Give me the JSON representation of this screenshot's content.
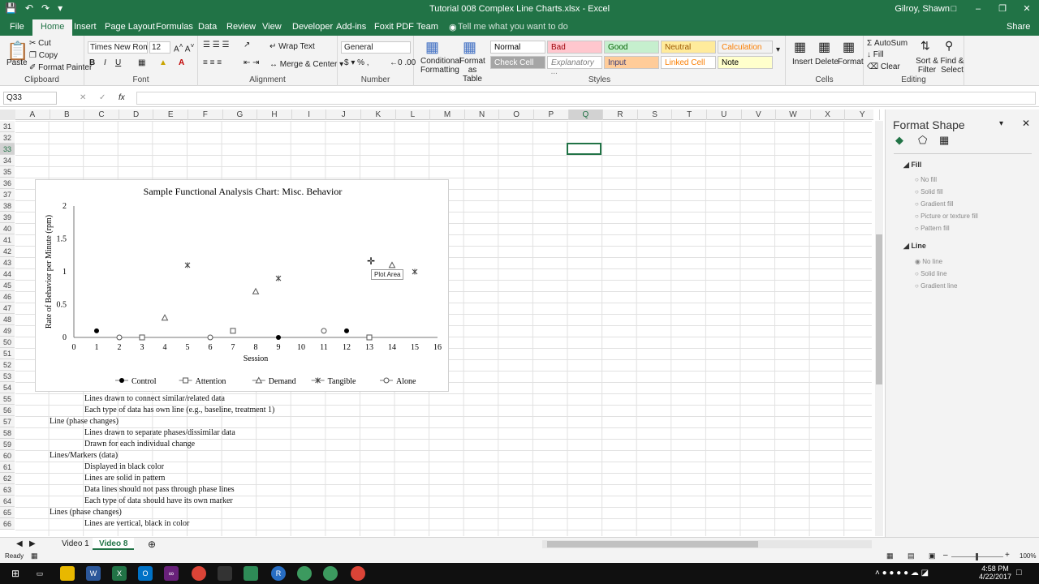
{
  "window": {
    "title": "Tutorial 008 Complex Line Charts.xlsx  -  Excel",
    "user": "Gilroy, Shawn",
    "share": "Share"
  },
  "tabs": [
    "File",
    "Home",
    "Insert",
    "Page Layout",
    "Formulas",
    "Data",
    "Review",
    "View",
    "Developer",
    "Add-ins",
    "Foxit PDF",
    "Team"
  ],
  "tell_me": "Tell me what you want to do",
  "ribbon": {
    "clipboard": {
      "label": "Clipboard",
      "paste": "Paste",
      "cut": "Cut",
      "copy": "Copy",
      "painter": "Format Painter"
    },
    "font": {
      "label": "Font",
      "name": "Times New Roma",
      "size": "12"
    },
    "alignment": {
      "label": "Alignment",
      "wrap": "Wrap Text",
      "merge": "Merge & Center"
    },
    "number": {
      "label": "Number",
      "format": "General"
    },
    "styles": {
      "label": "Styles",
      "cond": "Conditional Formatting",
      "table": "Format as Table",
      "cells": [
        {
          "name": "Normal",
          "bg": "#ffffff",
          "fg": "#000000"
        },
        {
          "name": "Bad",
          "bg": "#ffc7ce",
          "fg": "#9c0006"
        },
        {
          "name": "Good",
          "bg": "#c6efce",
          "fg": "#006100"
        },
        {
          "name": "Neutral",
          "bg": "#ffeb9c",
          "fg": "#9c5700"
        },
        {
          "name": "Calculation",
          "bg": "#f2f2f2",
          "fg": "#fa7d00"
        },
        {
          "name": "Check Cell",
          "bg": "#a5a5a5",
          "fg": "#ffffff"
        },
        {
          "name": "Explanatory ...",
          "bg": "#ffffff",
          "fg": "#7f7f7f"
        },
        {
          "name": "Input",
          "bg": "#ffcc99",
          "fg": "#3f3f76"
        },
        {
          "name": "Linked Cell",
          "bg": "#ffffff",
          "fg": "#fa7d00"
        },
        {
          "name": "Note",
          "bg": "#ffffcc",
          "fg": "#000000"
        }
      ]
    },
    "cells": {
      "label": "Cells",
      "insert": "Insert",
      "delete": "Delete",
      "format": "Format"
    },
    "editing": {
      "label": "Editing",
      "autosum": "AutoSum",
      "fill": "Fill",
      "clear": "Clear",
      "sort": "Sort & Filter",
      "find": "Find & Select"
    }
  },
  "namebox": "Q33",
  "columns": [
    "A",
    "B",
    "C",
    "D",
    "E",
    "F",
    "G",
    "H",
    "I",
    "J",
    "K",
    "L",
    "M",
    "N",
    "O",
    "P",
    "Q",
    "R",
    "S",
    "T",
    "U",
    "V",
    "W",
    "X",
    "Y"
  ],
  "rows": [
    "31",
    "32",
    "33",
    "34",
    "35",
    "36",
    "37",
    "38",
    "39",
    "40",
    "41",
    "42",
    "43",
    "44",
    "45",
    "46",
    "47",
    "48",
    "49",
    "50",
    "51",
    "52",
    "53",
    "54",
    "55",
    "56",
    "57",
    "58",
    "59",
    "60",
    "61",
    "62",
    "63",
    "64",
    "65",
    "66"
  ],
  "sheet_text": [
    {
      "t": "Lines drawn to connect similar/related data",
      "indent": true
    },
    {
      "t": "Each type of data has own line (e.g., baseline, treatment 1)",
      "indent": true
    },
    {
      "t": "Line (phase changes)",
      "indent": false
    },
    {
      "t": "Lines drawn to separate phases/dissimilar data",
      "indent": true
    },
    {
      "t": "Drawn for each individual change",
      "indent": true
    },
    {
      "t": "Lines/Markers (data)",
      "indent": false
    },
    {
      "t": "Displayed in black color",
      "indent": true
    },
    {
      "t": "Lines are solid in pattern",
      "indent": true
    },
    {
      "t": "Data lines should not pass through phase lines",
      "indent": true
    },
    {
      "t": "Each type of data should have its own marker",
      "indent": true
    },
    {
      "t": "Lines (phase changes)",
      "indent": false
    },
    {
      "t": "Lines are vertical, black in color",
      "indent": true
    }
  ],
  "chart_data": {
    "type": "scatter",
    "title": "Sample Functional Analysis Chart: Misc. Behavior",
    "xlabel": "Session",
    "ylabel": "Rate of Behavior per Minute (rpm)",
    "xlim": [
      0,
      16
    ],
    "ylim": [
      0,
      2
    ],
    "xticks": [
      "0",
      "1",
      "2",
      "3",
      "4",
      "5",
      "6",
      "7",
      "8",
      "9",
      "10",
      "11",
      "12",
      "13",
      "14",
      "15",
      "16"
    ],
    "yticks": [
      "0",
      "0.5",
      "1",
      "1.5",
      "2"
    ],
    "legend": "bottom",
    "series": [
      {
        "name": "Control",
        "marker": "filled-circle",
        "points": [
          [
            1,
            0.1
          ],
          [
            9,
            0
          ],
          [
            12,
            0.1
          ]
        ]
      },
      {
        "name": "Attention",
        "marker": "square",
        "points": [
          [
            3,
            0
          ],
          [
            7,
            0.1
          ],
          [
            13,
            0
          ]
        ]
      },
      {
        "name": "Demand",
        "marker": "triangle",
        "points": [
          [
            4,
            0.3
          ],
          [
            8,
            0.7
          ],
          [
            14,
            1.1
          ]
        ]
      },
      {
        "name": "Tangible",
        "marker": "star",
        "points": [
          [
            5,
            1.1
          ],
          [
            9,
            0.9
          ],
          [
            15,
            1.0
          ]
        ]
      },
      {
        "name": "Alone",
        "marker": "circle",
        "points": [
          [
            2,
            0
          ],
          [
            6,
            0
          ],
          [
            11,
            0.1
          ]
        ]
      }
    ],
    "tooltip": "Plot Area"
  },
  "pane": {
    "title": "Format Shape",
    "fill_label": "Fill",
    "fill_opts": [
      "No fill",
      "Solid fill",
      "Gradient fill",
      "Picture or texture fill",
      "Pattern fill"
    ],
    "line_label": "Line",
    "line_opts": [
      "No line",
      "Solid line",
      "Gradient line"
    ]
  },
  "sheet_tabs": [
    "Video 1",
    "Video 8"
  ],
  "status": {
    "ready": "Ready",
    "zoom": "100%"
  },
  "clock": {
    "time": "4:58 PM",
    "date": "4/22/2017"
  }
}
